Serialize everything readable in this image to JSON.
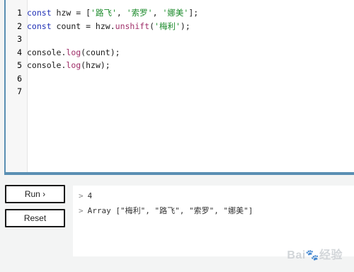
{
  "editor": {
    "lines": [
      {
        "num": "1",
        "tokens": [
          {
            "t": "const",
            "c": "kw"
          },
          {
            "t": " hzw = [",
            "c": ""
          },
          {
            "t": "'路飞'",
            "c": "str"
          },
          {
            "t": ", ",
            "c": ""
          },
          {
            "t": "'索罗'",
            "c": "str"
          },
          {
            "t": ", ",
            "c": ""
          },
          {
            "t": "'娜美'",
            "c": "str"
          },
          {
            "t": "];",
            "c": ""
          }
        ]
      },
      {
        "num": "2",
        "tokens": [
          {
            "t": "const",
            "c": "kw"
          },
          {
            "t": " count = hzw.",
            "c": ""
          },
          {
            "t": "unshift",
            "c": "fn"
          },
          {
            "t": "(",
            "c": ""
          },
          {
            "t": "'梅利'",
            "c": "str"
          },
          {
            "t": ");",
            "c": ""
          }
        ]
      },
      {
        "num": "3",
        "tokens": []
      },
      {
        "num": "4",
        "tokens": [
          {
            "t": "console.",
            "c": ""
          },
          {
            "t": "log",
            "c": "fn"
          },
          {
            "t": "(count);",
            "c": ""
          }
        ]
      },
      {
        "num": "5",
        "tokens": [
          {
            "t": "console.",
            "c": ""
          },
          {
            "t": "log",
            "c": "fn"
          },
          {
            "t": "(hzw);",
            "c": ""
          }
        ]
      },
      {
        "num": "6",
        "tokens": []
      },
      {
        "num": "7",
        "tokens": []
      }
    ]
  },
  "buttons": {
    "run_label": "Run ›",
    "reset_label": "Reset"
  },
  "console": {
    "outputs": [
      {
        "prompt": ">",
        "text": "4"
      },
      {
        "prompt": ">",
        "text": "Array [\"梅利\", \"路飞\", \"索罗\", \"娜美\"]"
      }
    ]
  },
  "watermark": {
    "text": "Bai",
    "icon": "paw-icon",
    "suffix": "经验"
  }
}
